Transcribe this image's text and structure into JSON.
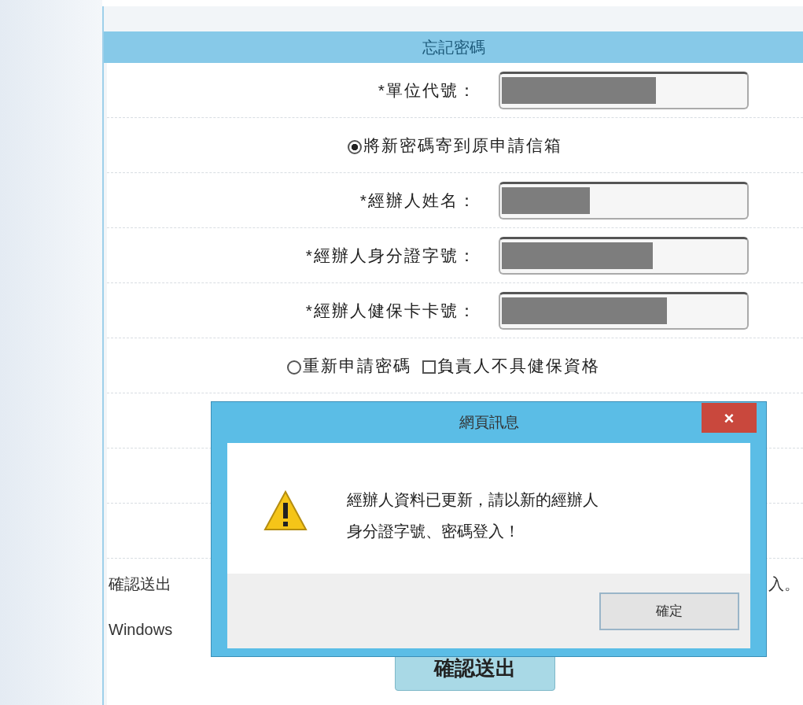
{
  "form": {
    "title": "忘記密碼",
    "rows": [
      {
        "kind": "field",
        "label": "*單位代號："
      },
      {
        "kind": "radio",
        "label": "將新密碼寄到原申請信箱",
        "selected": true
      },
      {
        "kind": "field",
        "label": "*經辦人姓名："
      },
      {
        "kind": "field",
        "label": "*經辦人身分證字號："
      },
      {
        "kind": "field",
        "label": "*經辦人健保卡卡號："
      },
      {
        "kind": "options",
        "items": [
          {
            "kind": "radio",
            "label": "重新申請密碼",
            "selected": false
          },
          {
            "kind": "checkbox",
            "label": "負責人不具健保資格",
            "checked": false
          }
        ]
      },
      {
        "kind": "blank"
      },
      {
        "kind": "blank"
      },
      {
        "kind": "blank"
      }
    ],
    "notes": [
      {
        "left": "確認送出",
        "right": "入。"
      },
      {
        "left": "Windows"
      }
    ],
    "submit": "確認送出"
  },
  "dialog": {
    "title": "網頁訊息",
    "close": "×",
    "message": [
      "經辦人資料已更新，請以新的經辦人",
      "身分證字號、密碼登入！"
    ],
    "ok": "確定"
  }
}
